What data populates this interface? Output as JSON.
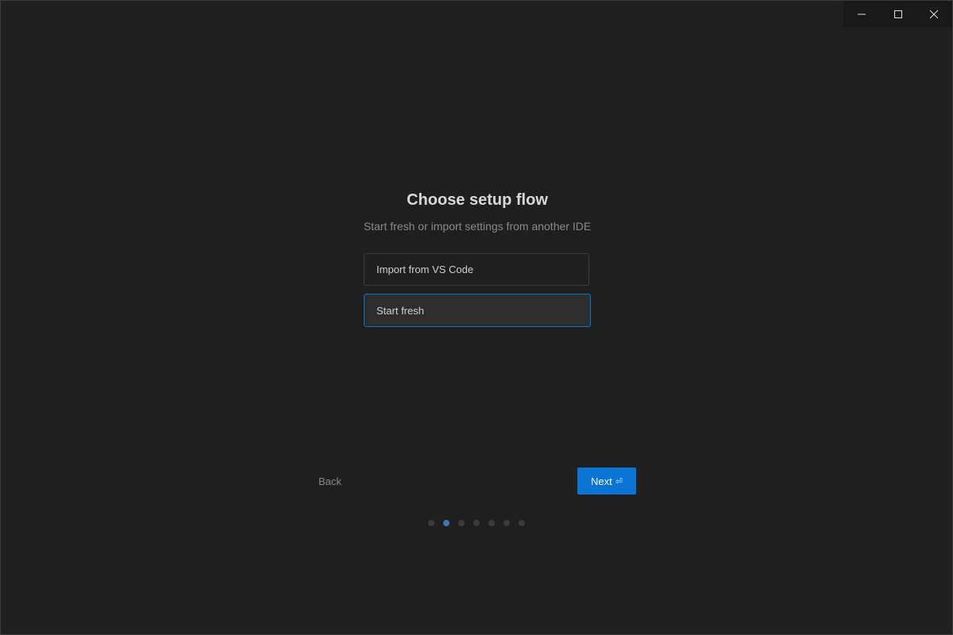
{
  "window_controls": {
    "minimize_icon": "minimize-icon",
    "maximize_icon": "maximize-icon",
    "close_icon": "close-icon"
  },
  "setup": {
    "title": "Choose setup flow",
    "subtitle": "Start fresh or import settings from another IDE",
    "options": [
      {
        "label": "Import from VS Code",
        "selected": false
      },
      {
        "label": "Start fresh",
        "selected": true
      }
    ],
    "back_label": "Back",
    "next_label": "Next",
    "next_icon": "enter-key-icon",
    "progress": {
      "total_steps": 7,
      "current_step": 2
    }
  },
  "colors": {
    "background": "#1f1f1f",
    "accent": "#0a74d4",
    "selected_border": "#0a74c7",
    "active_dot": "#3b78b8"
  }
}
